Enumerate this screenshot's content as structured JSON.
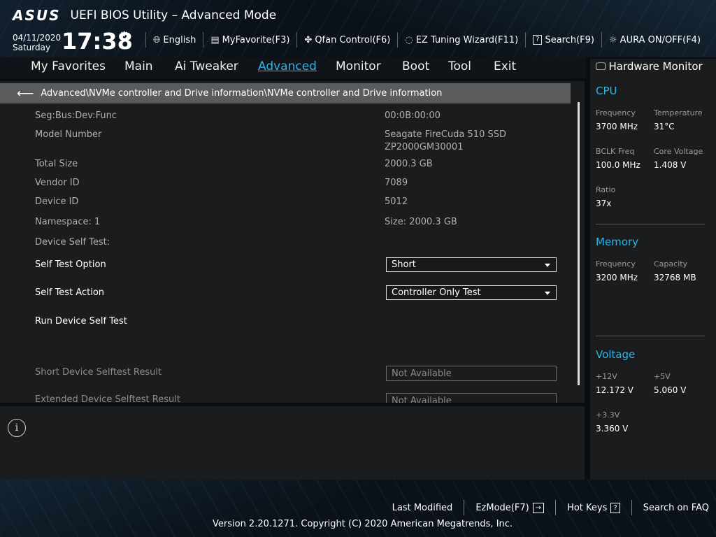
{
  "header": {
    "logo": "ASUS",
    "title": "UEFI BIOS Utility – Advanced Mode",
    "date": "04/11/2020",
    "weekday": "Saturday",
    "time": "17:38",
    "tools": [
      {
        "label": "English",
        "icon": "globe-icon"
      },
      {
        "label": "MyFavorite(F3)",
        "icon": "favorite-icon"
      },
      {
        "label": "Qfan Control(F6)",
        "icon": "fan-icon"
      },
      {
        "label": "EZ Tuning Wizard(F11)",
        "icon": "lightbulb-icon"
      },
      {
        "label": "Search(F9)",
        "icon": "help-box-icon"
      },
      {
        "label": "AURA ON/OFF(F4)",
        "icon": "aura-icon"
      }
    ]
  },
  "menu": {
    "tabs": [
      "My Favorites",
      "Main",
      "Ai Tweaker",
      "Advanced",
      "Monitor",
      "Boot",
      "Tool",
      "Exit"
    ],
    "active": "Advanced"
  },
  "breadcrumb": "Advanced\\NVMe controller and Drive information\\NVMe controller and Drive information",
  "fields": {
    "seg_label": "Seg:Bus:Dev:Func",
    "seg_value": "00:0B:00:00",
    "model_label": "Model Number",
    "model_value_line1": "Seagate FireCuda 510 SSD",
    "model_value_line2": "ZP2000GM30001",
    "size_label": "Total Size",
    "size_value": "2000.3 GB",
    "vendor_label": "Vendor ID",
    "vendor_value": "7089",
    "device_label": "Device ID",
    "device_value": "5012",
    "ns_label": "Namespace: 1",
    "ns_value": "Size: 2000.3 GB",
    "selftest_label": "Device Self Test:",
    "option_label": "Self Test Option",
    "option_value": "Short",
    "action_label": "Self Test Action",
    "action_value": "Controller Only Test",
    "run_label": "Run Device Self Test",
    "short_result_label": "Short Device Selftest Result",
    "short_result_value": "Not Available",
    "ext_result_label": "Extended Device Selftest Result",
    "ext_result_value": "Not Available"
  },
  "hardware_monitor": {
    "title": "Hardware Monitor",
    "cpu": {
      "title": "CPU",
      "freq_label": "Frequency",
      "freq_value": "3700 MHz",
      "temp_label": "Temperature",
      "temp_value": "31°C",
      "bclk_label": "BCLK Freq",
      "bclk_value": "100.0 MHz",
      "vcore_label": "Core Voltage",
      "vcore_value": "1.408 V",
      "ratio_label": "Ratio",
      "ratio_value": "37x"
    },
    "memory": {
      "title": "Memory",
      "freq_label": "Frequency",
      "freq_value": "3200 MHz",
      "cap_label": "Capacity",
      "cap_value": "32768 MB"
    },
    "voltage": {
      "title": "Voltage",
      "v12_label": "+12V",
      "v12_value": "12.172 V",
      "v5_label": "+5V",
      "v5_value": "5.060 V",
      "v33_label": "+3.3V",
      "v33_value": "3.360 V"
    }
  },
  "footer": {
    "last_modified": "Last Modified",
    "ezmode": "EzMode(F7)",
    "ezmode_icon": "→",
    "hotkeys": "Hot Keys",
    "hotkeys_icon": "?",
    "faq": "Search on FAQ",
    "copyright": "Version 2.20.1271. Copyright (C) 2020 American Megatrends, Inc."
  },
  "colors": {
    "accent": "#2fb5e6",
    "panel": "#1b1c1e",
    "breadcrumb_bg": "#5a5b5d"
  }
}
